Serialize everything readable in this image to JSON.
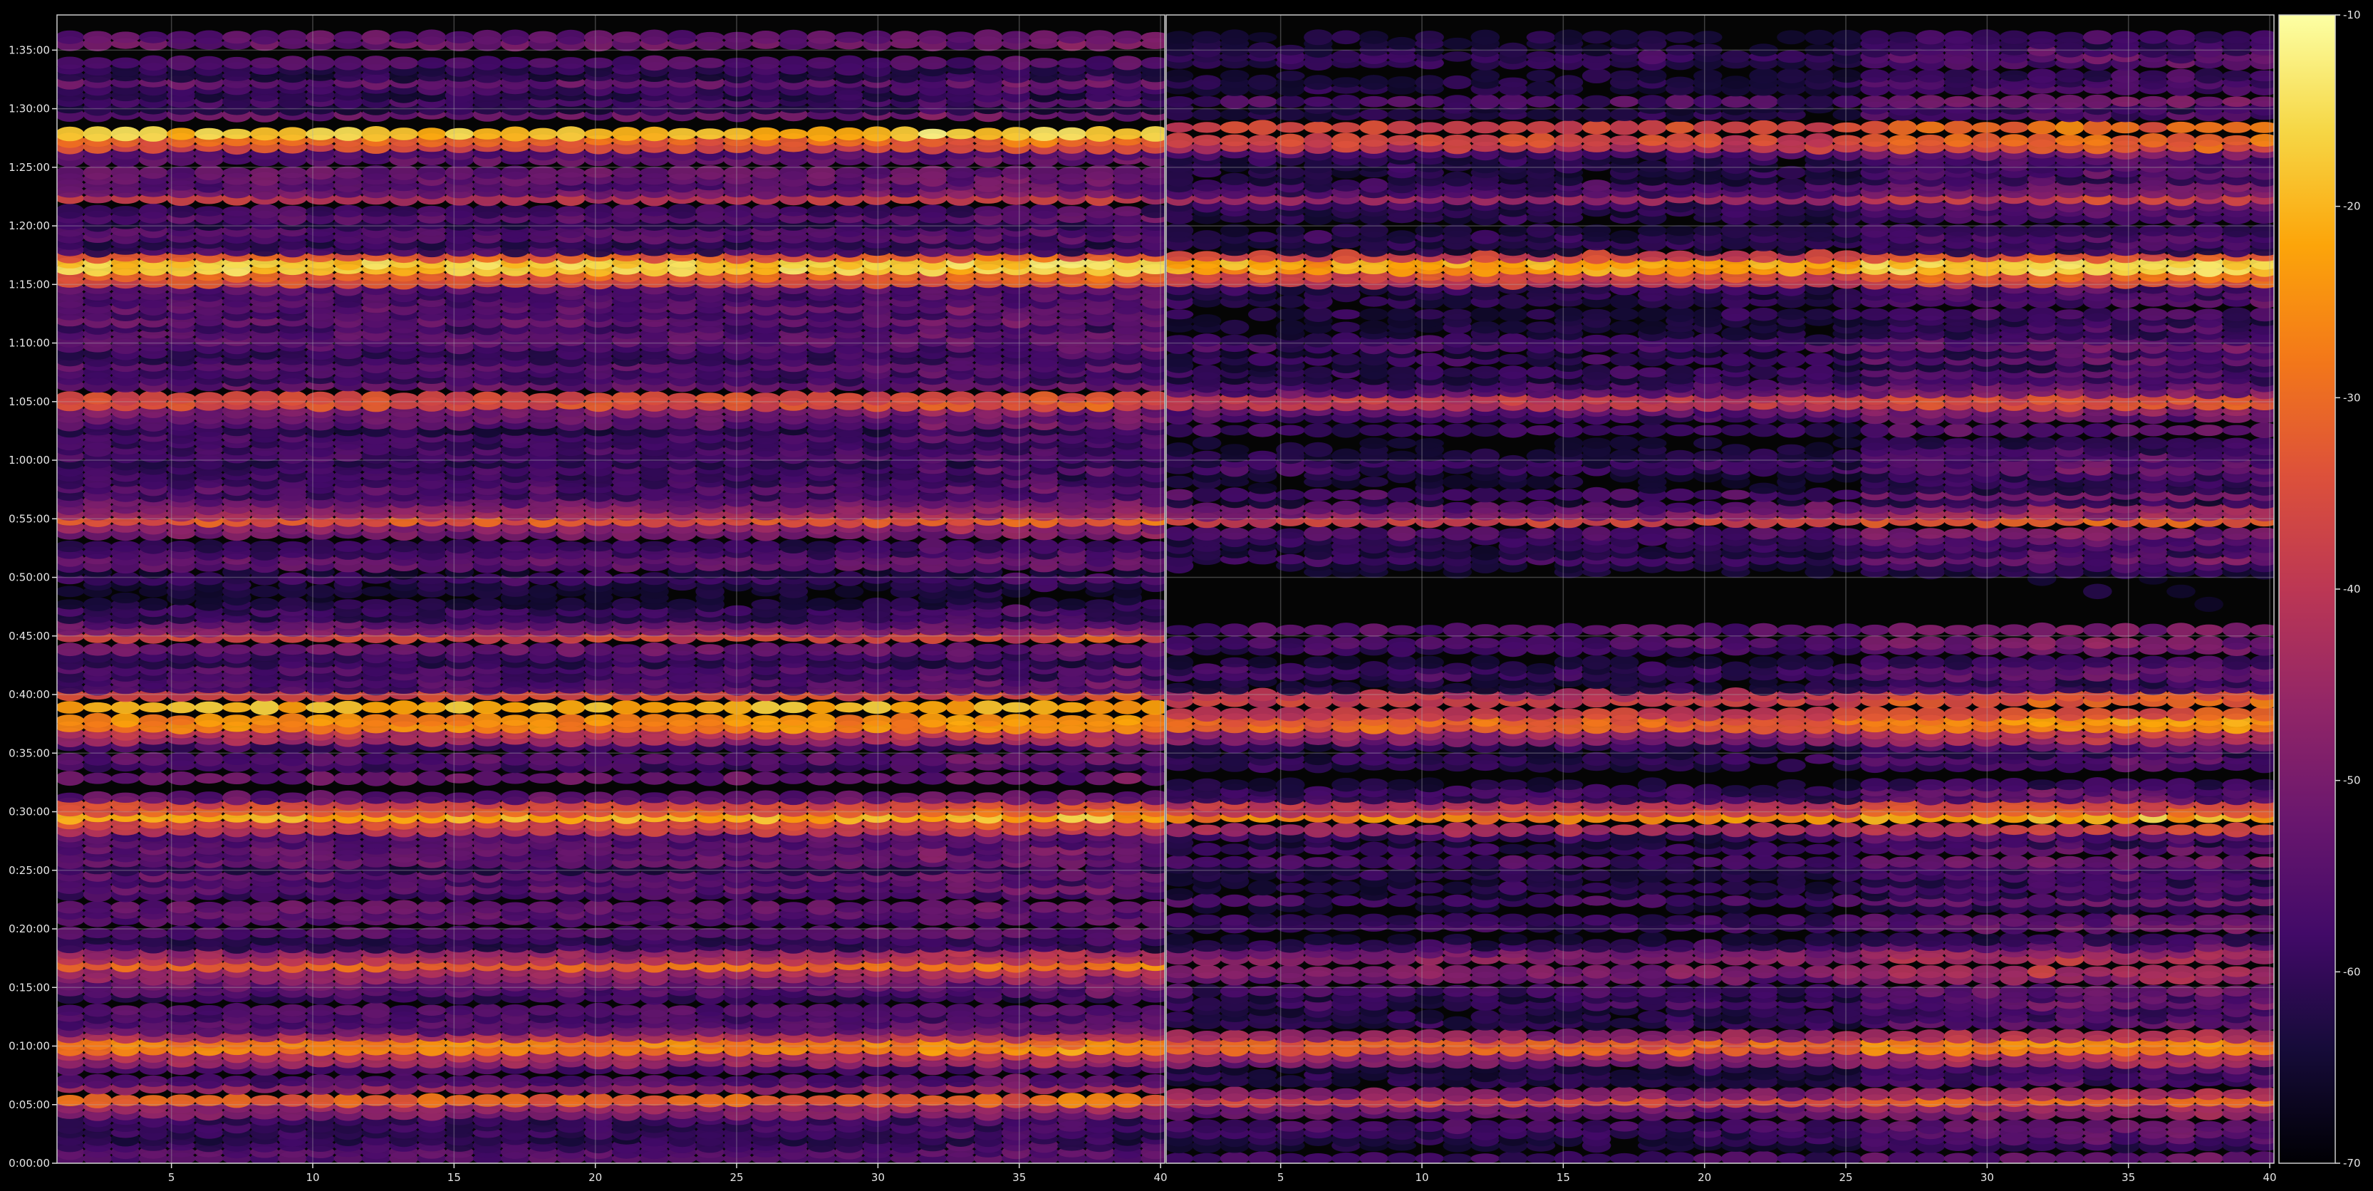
{
  "chart_data": {
    "type": "heatmap",
    "title": "",
    "xlabel": "",
    "ylabel": "",
    "colormap": "inferno",
    "background": "#000000",
    "grid": true,
    "panels": [
      {
        "x_range": [
          1,
          40
        ],
        "x_ticks": [
          "5",
          "10",
          "15",
          "20",
          "25",
          "30",
          "35",
          "40"
        ]
      },
      {
        "x_range": [
          1,
          40
        ],
        "x_ticks": [
          "5",
          "10",
          "15",
          "20",
          "25",
          "30",
          "35",
          "40"
        ]
      }
    ],
    "y_ticks": [
      "0:00:00",
      "0:05:00",
      "0:10:00",
      "0:15:00",
      "0:20:00",
      "0:25:00",
      "0:30:00",
      "0:35:00",
      "0:40:00",
      "0:45:00",
      "0:50:00",
      "0:55:00",
      "1:00:00",
      "1:05:00",
      "1:10:00",
      "1:15:00",
      "1:20:00",
      "1:25:00",
      "1:30:00",
      "1:35:00"
    ],
    "y_range_minutes": [
      0,
      98
    ],
    "colorbar": {
      "range": [
        -70,
        -10
      ],
      "ticks": [
        "-10",
        "-20",
        "-30",
        "-40",
        "-50",
        "-60",
        "-70"
      ],
      "tick_values": [
        -10,
        -20,
        -30,
        -40,
        -50,
        -60,
        -70
      ]
    },
    "bright_rows": [
      {
        "time": "1:27:50",
        "level": -18
      },
      {
        "time": "1:16:30",
        "level": -17
      },
      {
        "time": "0:39:00",
        "level": -20
      },
      {
        "time": "0:29:45",
        "level": -21
      },
      {
        "time": "0:37:30",
        "level": -26
      },
      {
        "time": "0:10:00",
        "level": -27
      },
      {
        "time": "0:17:00",
        "level": -30
      },
      {
        "time": "0:05:30",
        "level": -31
      },
      {
        "time": "0:55:00",
        "level": -33
      },
      {
        "time": "1:05:00",
        "level": -35
      },
      {
        "time": "0:45:00",
        "level": -37
      },
      {
        "time": "1:22:30",
        "level": -40
      }
    ]
  }
}
